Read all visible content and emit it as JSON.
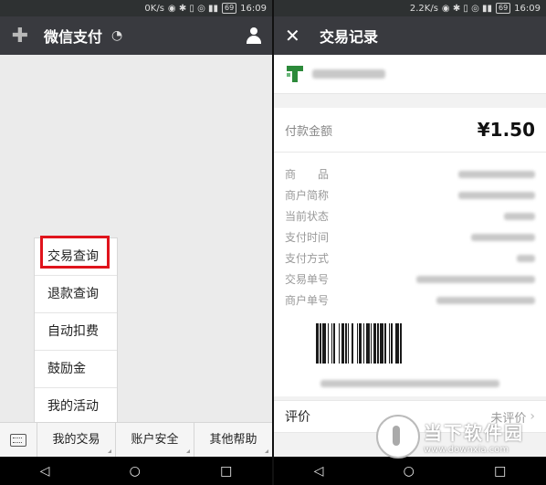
{
  "left": {
    "status": {
      "speed": "0K/s",
      "battery": "69",
      "time": "16:09"
    },
    "header": {
      "title": "微信支付"
    },
    "popup_menu": {
      "items": [
        {
          "label": "交易查询",
          "highlighted": true
        },
        {
          "label": "退款查询"
        },
        {
          "label": "自动扣费"
        },
        {
          "label": "鼓励金"
        },
        {
          "label": "我的活动"
        }
      ]
    },
    "bottom_menu": {
      "items": [
        {
          "label": "我的交易"
        },
        {
          "label": "账户安全"
        },
        {
          "label": "其他帮助"
        }
      ]
    }
  },
  "right": {
    "status": {
      "speed": "2.2K/s",
      "battery": "69",
      "time": "16:09"
    },
    "header": {
      "title": "交易记录"
    },
    "payment": {
      "label": "付款金额",
      "amount": "¥1.50"
    },
    "details": [
      {
        "label": "商　　品"
      },
      {
        "label": "商户简称"
      },
      {
        "label": "当前状态"
      },
      {
        "label": "支付时间"
      },
      {
        "label": "支付方式"
      },
      {
        "label": "交易单号"
      },
      {
        "label": "商户单号"
      }
    ],
    "rating": {
      "label": "评价",
      "value": "未评价"
    }
  },
  "watermark": {
    "title": "当下软件园",
    "url": "www.downxia.com"
  },
  "colors": {
    "appbar": "#393a3f",
    "highlight_box": "#e0141c",
    "statusbar": "#2e3132"
  }
}
